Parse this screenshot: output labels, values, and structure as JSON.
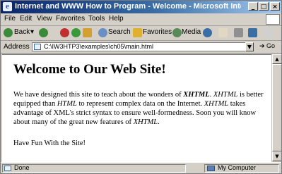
{
  "window": {
    "title": "Internet and WWW How to Program - Welcome - Microsoft Internet Explorer"
  },
  "menu": [
    "File",
    "Edit",
    "View",
    "Favorites",
    "Tools",
    "Help"
  ],
  "toolbar": {
    "back": "Back",
    "search": "Search",
    "favorites": "Favorites",
    "media": "Media"
  },
  "address": {
    "label": "Address",
    "url": "C:\\IW3HTP3\\examples\\ch05\\main.html",
    "go": "Go"
  },
  "page": {
    "heading": "Welcome to Our Web Site!",
    "para": {
      "t1": "We have designed this site to teach about the wonders of ",
      "xhtml_bold": "XHTML",
      "t2": ". ",
      "xhtml_it1": "XHTML",
      "t3": " is better equipped than ",
      "html_it": "HTML",
      "t4": " to represent complex data on the Internet. ",
      "xhtml_it2": "XHTML",
      "t5": " takes advantage of XML's strict syntax to ensure well-formedness. Soon you will know about many of the great new features of ",
      "xhtml_it3": "XHTML",
      "t6": "."
    },
    "para2": "Have Fun With the Site!"
  },
  "status": {
    "left": "Done",
    "zone": "My Computer"
  }
}
